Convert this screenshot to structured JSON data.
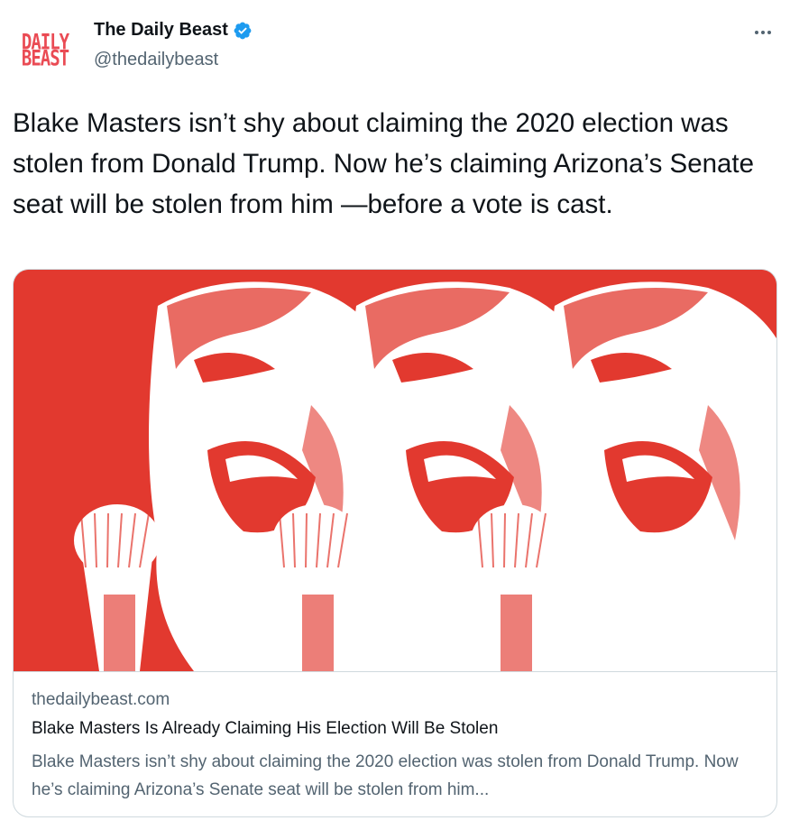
{
  "account": {
    "avatar_line1": "DAILY",
    "avatar_line2": "BEAST",
    "display_name": "The Daily Beast",
    "handle": "@thedailybeast",
    "verified": true
  },
  "tweet": {
    "text": "Blake Masters isn’t shy about claiming the 2020 election was stolen from Donald Trump. Now he’s claiming Arizona’s Senate seat will be stolen from him —before a vote is cast."
  },
  "card": {
    "domain": "thedailybeast.com",
    "title": "Blake Masters Is Already Claiming His Election Will Be Stolen",
    "description": "Blake Masters isn’t shy about claiming the 2020 election was stolen from Donald Trump. Now he’s claiming Arizona’s Senate seat will be stolen from him...",
    "image_colors": {
      "background": "#e2392f",
      "foreground": "#ffffff"
    }
  },
  "icons": {
    "verified": "verified-badge-icon",
    "more": "more-options-icon"
  },
  "colors": {
    "text_primary": "#0f1419",
    "text_secondary": "#536471",
    "verified_blue": "#1d9bf0",
    "brand_red": "#ea4b54",
    "border": "#cfd9de"
  }
}
